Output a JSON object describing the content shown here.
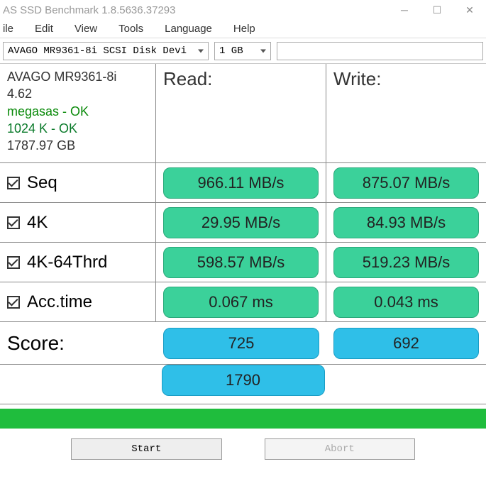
{
  "window": {
    "title": "AS SSD Benchmark 1.8.5636.37293"
  },
  "menu": {
    "file": "ile",
    "edit": "Edit",
    "view": "View",
    "tools": "Tools",
    "language": "Language",
    "help": "Help"
  },
  "toolbar": {
    "device": "AVAGO MR9361-8i SCSI Disk Devi",
    "size": "1 GB"
  },
  "info": {
    "name": "AVAGO MR9361-8i",
    "version": "4.62",
    "driver": "megasas - OK",
    "align": "1024 K - OK",
    "capacity": "1787.97 GB"
  },
  "headers": {
    "read": "Read:",
    "write": "Write:"
  },
  "tests": {
    "seq": {
      "label": "Seq",
      "read": "966.11 MB/s",
      "write": "875.07 MB/s"
    },
    "k4": {
      "label": "4K",
      "read": "29.95 MB/s",
      "write": "84.93 MB/s"
    },
    "k464": {
      "label": "4K-64Thrd",
      "read": "598.57 MB/s",
      "write": "519.23 MB/s"
    },
    "acc": {
      "label": "Acc.time",
      "read": "0.067 ms",
      "write": "0.043 ms"
    }
  },
  "score": {
    "label": "Score:",
    "read": "725",
    "write": "692",
    "total": "1790"
  },
  "buttons": {
    "start": "Start",
    "abort": "Abort"
  }
}
